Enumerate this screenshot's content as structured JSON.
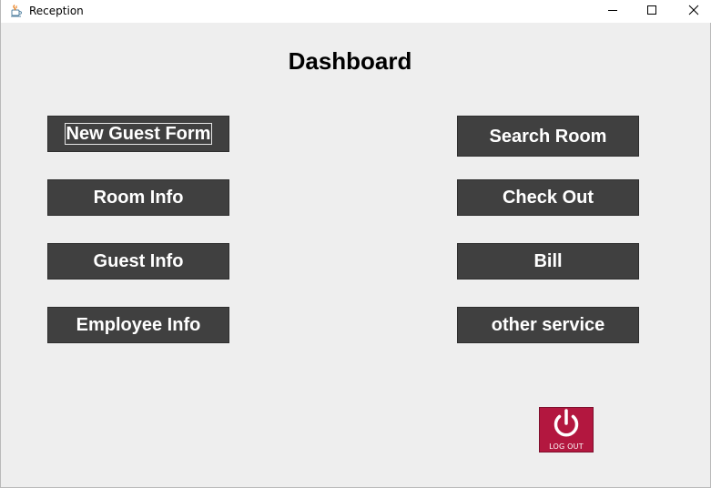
{
  "window": {
    "title": "Reception",
    "app_icon": "java-cup-icon",
    "controls": [
      "minimize-icon",
      "maximize-icon",
      "close-icon"
    ]
  },
  "dashboard": {
    "title": "Dashboard"
  },
  "left_buttons": [
    {
      "label": "New Guest Form",
      "focused": true
    },
    {
      "label": "Room Info"
    },
    {
      "label": "Guest Info"
    },
    {
      "label": "Employee Info"
    }
  ],
  "right_buttons": [
    {
      "label": "Search Room"
    },
    {
      "label": "Check Out"
    },
    {
      "label": "Bill"
    },
    {
      "label": "other service"
    }
  ],
  "logout": {
    "label": "LOG OUT",
    "icon": "power-icon"
  },
  "colors": {
    "button_bg": "#404040",
    "button_text": "#ffffff",
    "window_bg": "#eeeeee",
    "logout_bg": "#b3173f"
  }
}
